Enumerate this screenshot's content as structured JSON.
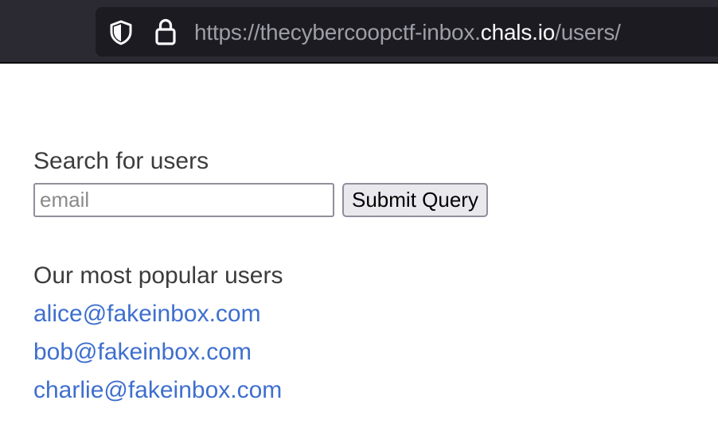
{
  "browser": {
    "url_prefix": "https://thecybercoopctf-inbox.",
    "url_domain": "chals.io",
    "url_path": "/users/",
    "icons": [
      "shield-icon",
      "lock-icon"
    ]
  },
  "search": {
    "label": "Search for users",
    "placeholder": "email",
    "value": "",
    "submit_label": "Submit Query"
  },
  "popular": {
    "heading": "Our most popular users",
    "users": [
      "alice@fakeinbox.com",
      "bob@fakeinbox.com",
      "charlie@fakeinbox.com"
    ]
  },
  "colors": {
    "link": "#3e6fce",
    "text": "#3c3c3c",
    "toolbar": "#2b2a33",
    "urlbar": "#1c1b22"
  }
}
